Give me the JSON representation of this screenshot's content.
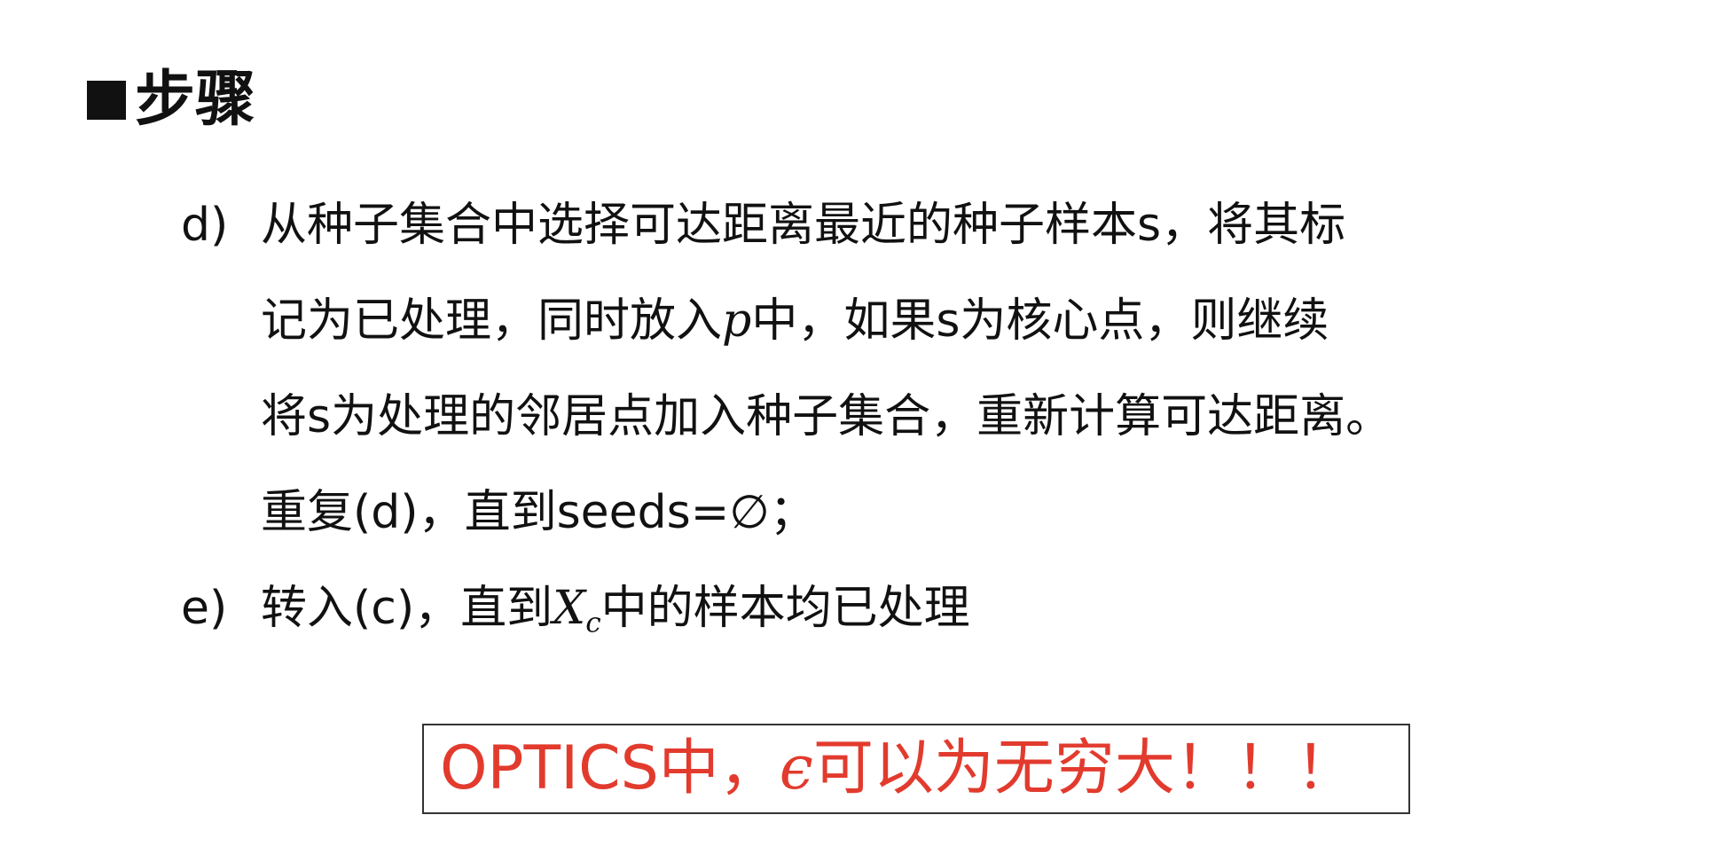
{
  "heading": {
    "marker_icon": "black-square-bullet",
    "title": "步骤"
  },
  "steps": [
    {
      "marker": "d)",
      "lines": [
        [
          {
            "t": "从种子集合中选择可达距离最近的种子样本s，将其标"
          }
        ],
        [
          {
            "t": "记为已处理，同时放入"
          },
          {
            "t": "p",
            "math": true
          },
          {
            "t": "中，如果s为核心点，则继续"
          }
        ],
        [
          {
            "t": "将s为处理的邻居点加入种子集合，重新计算可达距离。"
          }
        ],
        [
          {
            "t": "重复(d)，直到seeds=∅；"
          }
        ]
      ]
    },
    {
      "marker": "e)",
      "lines": [
        [
          {
            "t": "转入(c)，直到"
          },
          {
            "t": "X",
            "math": true,
            "sub": "c"
          },
          {
            "t": "中的样本均已处理"
          }
        ]
      ]
    }
  ],
  "note": {
    "color": "#e23b2e",
    "before": "OPTICS中，",
    "symbol": "ϵ",
    "after": "可以为无穷大！！！"
  }
}
